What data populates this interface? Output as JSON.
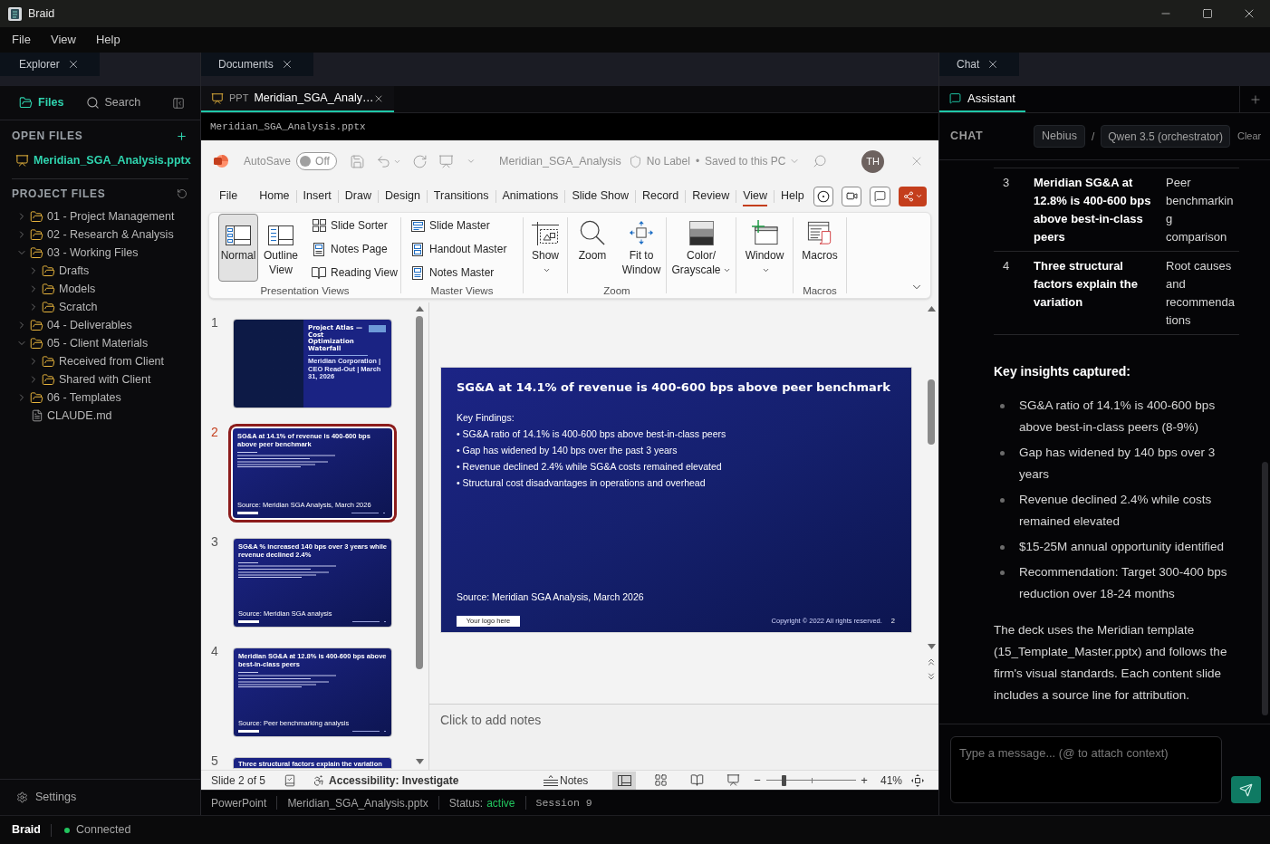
{
  "window": {
    "title": "Braid"
  },
  "menu": [
    "File",
    "View",
    "Help"
  ],
  "explorer": {
    "panel_tab": "Explorer",
    "modes": [
      {
        "label": "Files",
        "selected": true
      },
      {
        "label": "Search",
        "selected": false
      }
    ],
    "open_files": {
      "title": "OPEN FILES",
      "files": [
        {
          "name": "Meridian_SGA_Analysis.pptx",
          "selected": true
        }
      ]
    },
    "project_files": {
      "title": "PROJECT FILES",
      "tree": [
        {
          "kind": "folder",
          "name": "01 - Project Management",
          "expanded": false
        },
        {
          "kind": "folder",
          "name": "02 - Research & Analysis",
          "expanded": false
        },
        {
          "kind": "folder",
          "name": "03 - Working Files",
          "expanded": true,
          "children": [
            {
              "kind": "folder",
              "name": "Drafts",
              "expanded": false
            },
            {
              "kind": "folder",
              "name": "Models",
              "expanded": false
            },
            {
              "kind": "folder",
              "name": "Scratch",
              "expanded": false
            }
          ]
        },
        {
          "kind": "folder",
          "name": "04 - Deliverables",
          "expanded": false
        },
        {
          "kind": "folder",
          "name": "05 - Client Materials",
          "expanded": true,
          "children": [
            {
              "kind": "folder",
              "name": "Received from Client",
              "expanded": false
            },
            {
              "kind": "folder",
              "name": "Shared with Client",
              "expanded": false
            }
          ]
        },
        {
          "kind": "folder",
          "name": "06 - Templates",
          "expanded": false
        },
        {
          "kind": "file",
          "name": "CLAUDE.md"
        }
      ]
    },
    "settings": "Settings"
  },
  "documents": {
    "panel_tab": "Documents",
    "tabs": [
      {
        "file_type": "PPT",
        "title": "Meridian_SGA_Analy…",
        "selected": true
      }
    ],
    "path": "Meridian_SGA_Analysis.pptx",
    "powerpoint": {
      "title_row": {
        "autosave_label": "AutoSave",
        "autosave": {
          "on": false,
          "text": "Off"
        },
        "file_name": "Meridian_SGA_Analysis",
        "sensitivity": "No Label",
        "separator": "•",
        "save_status": "Saved to this PC",
        "user_initials": "TH"
      },
      "ribbon_tabs": [
        {
          "label": "File",
          "selected": false
        },
        {
          "label": "Home",
          "selected": false
        },
        {
          "label": "Insert",
          "selected": false
        },
        {
          "label": "Draw",
          "selected": false
        },
        {
          "label": "Design",
          "selected": false
        },
        {
          "label": "Transitions",
          "selected": false
        },
        {
          "label": "Animations",
          "selected": false
        },
        {
          "label": "Slide Show",
          "selected": false
        },
        {
          "label": "Record",
          "selected": false
        },
        {
          "label": "Review",
          "selected": false
        },
        {
          "label": "View",
          "selected": true
        },
        {
          "label": "Help",
          "selected": false
        }
      ],
      "ribbon_groups": [
        {
          "label": "Presentation Views",
          "buttons": [
            {
              "kind": "large",
              "label": "Normal",
              "selected": true,
              "dropdown": false
            },
            {
              "kind": "large",
              "label": "Outline View",
              "selected": false,
              "dropdown": false
            },
            {
              "kind": "small",
              "label": "Slide Sorter",
              "selected": false,
              "dropdown": false
            },
            {
              "kind": "small",
              "label": "Notes Page",
              "selected": false,
              "dropdown": false
            },
            {
              "kind": "small",
              "label": "Reading View",
              "selected": false,
              "dropdown": false
            }
          ]
        },
        {
          "label": "Master Views",
          "buttons": [
            {
              "kind": "small",
              "label": "Slide Master",
              "dropdown": false
            },
            {
              "kind": "small",
              "label": "Handout Master",
              "dropdown": false
            },
            {
              "kind": "small",
              "label": "Notes Master",
              "dropdown": false
            }
          ]
        },
        {
          "buttons": [
            {
              "kind": "large",
              "label": "Show",
              "dropdown": true
            }
          ]
        },
        {
          "label": "Zoom",
          "buttons": [
            {
              "kind": "large",
              "label": "Zoom",
              "dropdown": false
            },
            {
              "kind": "large",
              "label": "Fit to Window",
              "dropdown": false
            }
          ]
        },
        {
          "buttons": [
            {
              "kind": "large",
              "label": "Color/ Grayscale",
              "dropdown": true
            }
          ]
        },
        {
          "buttons": [
            {
              "kind": "large",
              "label": "Window",
              "dropdown": true
            }
          ]
        },
        {
          "label": "Macros",
          "buttons": [
            {
              "kind": "large",
              "label": "Macros",
              "dropdown": false
            }
          ]
        }
      ],
      "slides": [
        {
          "number": "1",
          "kind": "title",
          "selected": false,
          "title": "Project Atlas — Cost Optimization Waterfall",
          "subtitle": "Meridian Corporation | CEO Read-Out | March 31, 2026"
        },
        {
          "number": "2",
          "kind": "content",
          "selected": true,
          "title": "SG&A at 14.1% of revenue is 400-600 bps above peer benchmark",
          "source": "Source: Meridian SGA Analysis, March 2026"
        },
        {
          "number": "3",
          "kind": "content",
          "selected": false,
          "title": "SG&A % increased 140 bps over 3 years while revenue declined 2.4%",
          "source": "Source: Meridian SGA analysis"
        },
        {
          "number": "4",
          "kind": "content",
          "selected": false,
          "title": "Meridian SG&A at 12.8% is 400-600 bps above best-in-class peers",
          "source": "Source: Peer benchmarking analysis"
        },
        {
          "number": "5",
          "kind": "partial",
          "selected": false,
          "title": "Three structural factors explain the variation"
        }
      ],
      "current_slide": {
        "title": "SG&A at 14.1% of revenue is 400-600 bps above peer benchmark",
        "heading": "Key Findings:",
        "bullets": [
          "• SG&A ratio of 14.1% is 400-600 bps above best-in-class peers",
          "• Gap has widened by 140 bps over the past 3 years",
          "• Revenue declined 2.4% while SG&A costs remained elevated",
          "• Structural cost disadvantages in operations and overhead"
        ],
        "source": "Source: Meridian SGA Analysis, March 2026",
        "logo": "Your logo here",
        "copyright": "Copyright © 2022 All rights reserved.",
        "page_number": "2"
      },
      "notes": {
        "placeholder": "Click to add notes"
      },
      "status": {
        "slide_position": "Slide 2 of 5",
        "accessibility": "Accessibility: Investigate",
        "notes": "Notes",
        "view_buttons": [
          {
            "kind": "normal",
            "selected": true
          },
          {
            "kind": "sorter",
            "selected": false
          },
          {
            "kind": "reading",
            "selected": false
          },
          {
            "kind": "slideshow",
            "selected": false
          }
        ],
        "zoom": {
          "minus": "−",
          "plus": "+",
          "level": 0.19,
          "reading": "41%"
        }
      }
    },
    "status_bar": [
      {
        "kind": "text",
        "text": "PowerPoint"
      },
      {
        "kind": "text",
        "text": "Meridian_SGA_Analysis.pptx"
      },
      {
        "kind": "status",
        "label": "Status:",
        "value": "active"
      },
      {
        "kind": "mono",
        "text": "Session 9"
      }
    ]
  },
  "chat": {
    "panel_tab": "Chat",
    "tabs": [
      {
        "label": "Assistant",
        "selected": true
      }
    ],
    "header": {
      "title": "CHAT",
      "provider": "Nebius",
      "divider": "/",
      "model": "Qwen 3.5 (orchestrator)",
      "clear": "Clear"
    },
    "table_rows": [
      {
        "column_1": "3",
        "column_2": "Meridian SG&A at 12.8% is 400-600 bps above best-in-class peers",
        "column_3": "Peer benchmarking comparison"
      },
      {
        "column_1": "4",
        "column_2": "Three structural factors explain the variation",
        "column_3": "Root causes and recommendations"
      }
    ],
    "insights_heading": "Key insights captured:",
    "insights": [
      "SG&A ratio of 14.1% is 400-600 bps above best-in-class peers (8-9%)",
      "Gap has widened by 140 bps over 3 years",
      "Revenue declined 2.4% while costs remained elevated",
      "$15-25M annual opportunity identified",
      "Recommendation: Target 300-400 bps reduction over 18-24 months"
    ],
    "summary": "The deck uses the Meridian template (15_Template_Master.pptx) and follows the firm's visual standards. Each content slide includes a source line for attribution.",
    "input": {
      "placeholder": "Type a message... (@ to attach context)"
    }
  },
  "status_bar": {
    "app": "Braid",
    "connection": {
      "label": "Connected",
      "connected": true
    }
  }
}
